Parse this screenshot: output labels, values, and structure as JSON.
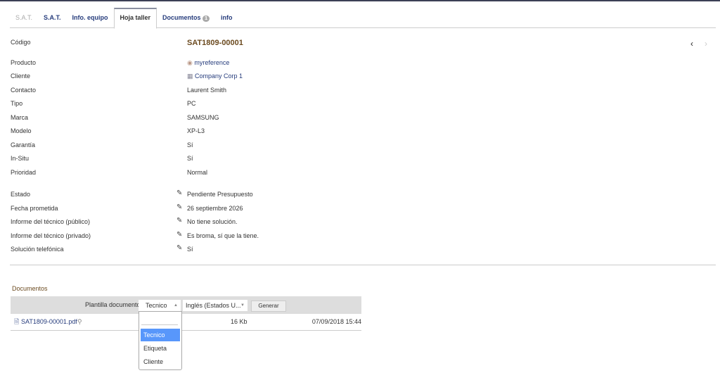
{
  "tabs": [
    {
      "label": "S.A.T."
    },
    {
      "label": "S.A.T."
    },
    {
      "label": "Info. equipo"
    },
    {
      "label": "Hoja taller"
    },
    {
      "label": "Documentos",
      "badge": "1"
    },
    {
      "label": "info"
    }
  ],
  "fields": [
    {
      "label": "Código",
      "value": "SAT1809-00001"
    },
    {
      "label": "Producto",
      "value": "myreference"
    },
    {
      "label": "Cliente",
      "value": "Company Corp 1"
    },
    {
      "label": "Contacto",
      "value": "Laurent Smith"
    },
    {
      "label": "Tipo",
      "value": "PC"
    },
    {
      "label": "Marca",
      "value": "SAMSUNG"
    },
    {
      "label": "Modelo",
      "value": "XP-L3"
    },
    {
      "label": "Garantía",
      "value": "Sí"
    },
    {
      "label": "In-Situ",
      "value": "Sí"
    },
    {
      "label": "Prioridad",
      "value": "Normal"
    }
  ],
  "editable_fields": [
    {
      "label": "Estado",
      "value": "Pendiente Presupuesto"
    },
    {
      "label": "Fecha prometida",
      "value": "26 septiembre 2026"
    },
    {
      "label": "Informe del técnico (público)",
      "value": "No tiene solución."
    },
    {
      "label": "Informe del técnico (privado)",
      "value": "Es broma, sí que la tiene."
    },
    {
      "label": "Solución telefónica",
      "value": "Sí"
    }
  ],
  "documents": {
    "title": "Documentos",
    "template_label": "Plantilla documento",
    "template_value": "Tecnico",
    "language_value": "Inglés (Estados U...",
    "generate": "Generar",
    "file": {
      "name": "SAT1809-00001.pdf",
      "size": "16 Kb",
      "date": "07/09/2018 15:44"
    },
    "options": [
      "Tecnico",
      "Etiqueta",
      "Cliente"
    ]
  }
}
